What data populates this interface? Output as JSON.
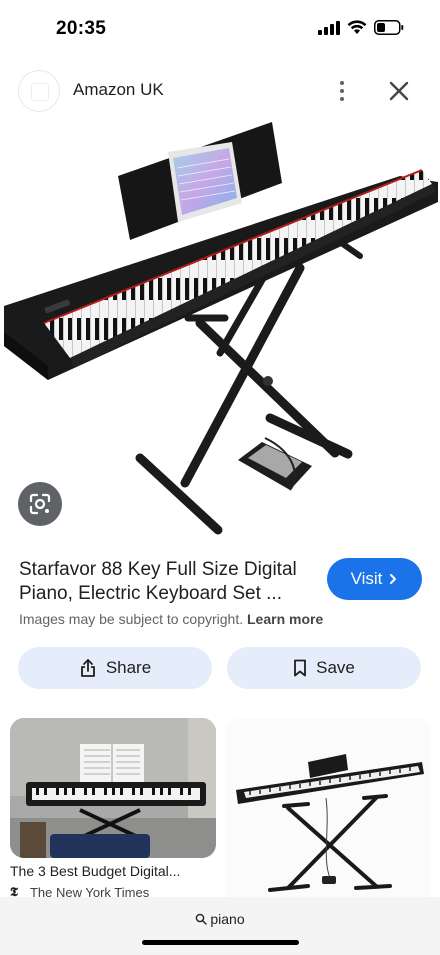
{
  "status_bar": {
    "time": "20:35",
    "icons": [
      "signal-icon",
      "wifi-icon",
      "battery-icon"
    ]
  },
  "source": {
    "name": "Amazon UK"
  },
  "result": {
    "title": "Starfavor 88 Key Full Size Digital Piano, Electric Keyboard Set ...",
    "visit_label": "Visit",
    "copyright_text": "Images may be subject to copyright.",
    "learn_more": "Learn more"
  },
  "actions": {
    "share_label": "Share",
    "save_label": "Save"
  },
  "related": [
    {
      "title": "The 3 Best Budget Digital...",
      "source": "The New York Times",
      "source_logo": "𝕿"
    },
    {
      "title": "",
      "source": ""
    }
  ],
  "search": {
    "query": "piano"
  },
  "colors": {
    "accent": "#1a73e8",
    "action_bg": "#e4edf9",
    "text": "#1f1f1f",
    "muted": "#5f6368"
  }
}
